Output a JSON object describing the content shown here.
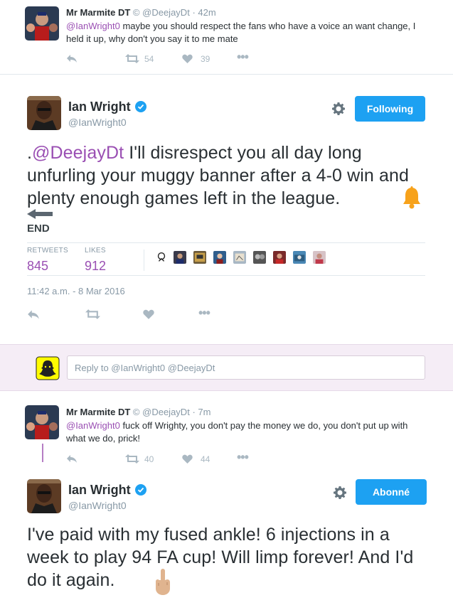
{
  "tweet1": {
    "name": "Mr Marmite DT",
    "copyright": "©",
    "handle": "@DeejayDt",
    "time": "· 42m",
    "mention": "@IanWright0",
    "text": " maybe you should respect the fans who have a voice an want change, I held it up, why don't you say it to me mate",
    "retweets": "54",
    "likes": "39"
  },
  "main_tweet": {
    "name": "Ian Wright",
    "handle": "@IanWright0",
    "follow_label": "Following",
    "mention": "@DeejayDt",
    "text_lead": ".",
    "text_body": " I'll disrespect you all day long unfurling your muggy banner after a 4-0 win and plenty enough games left in the league.",
    "end_label": "END",
    "retweets_label": "RETWEETS",
    "retweets": "845",
    "likes_label": "LIKES",
    "likes": "912",
    "timestamp": "11:42 a.m. - 8 Mar 2016"
  },
  "reply_box": {
    "placeholder": "Reply to @IanWright0 @DeejayDt"
  },
  "tweet3": {
    "name": "Mr Marmite DT",
    "copyright": "©",
    "handle": "@DeejayDt",
    "time": "· 7m",
    "mention": "@IanWright0",
    "text": " fuck off Wrighty, you don't pay the money we do, you don't put up with what we do, prick!",
    "retweets": "40",
    "likes": "44"
  },
  "tweet4": {
    "name": "Ian Wright",
    "handle": "@IanWright0",
    "follow_label": "Abonné",
    "text": "I've paid with my fused ankle! 6 injections in a week to play 94 FA cup! Will limp forever! And I'd do it again."
  },
  "colors": {
    "blue": "#1da1f2",
    "purple": "#9a4fb3",
    "grey": "#8899a6",
    "reply_bg": "#f5edf6"
  },
  "icons": [
    "reply-icon",
    "retweet-icon",
    "heart-icon",
    "more-icon",
    "gear-icon",
    "verified-icon",
    "bell-icon",
    "arrow-left-icon",
    "middle-finger-icon"
  ]
}
